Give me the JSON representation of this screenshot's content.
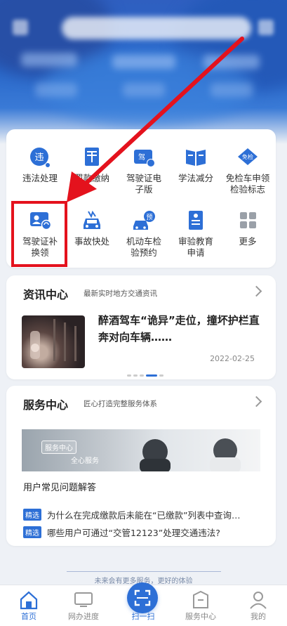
{
  "services_grid": {
    "items": [
      {
        "label": "违法处理",
        "icon": "violation-icon"
      },
      {
        "label": "罚款缴纳",
        "icon": "fine-payment-icon"
      },
      {
        "label": "驾驶证电\n子版",
        "icon": "e-license-icon"
      },
      {
        "label": "学法减分",
        "icon": "study-book-icon"
      },
      {
        "label": "免检车申领\n检验标志",
        "icon": "exempt-inspection-icon"
      },
      {
        "label": "驾驶证补\n换领",
        "icon": "license-renew-icon"
      },
      {
        "label": "事故快处",
        "icon": "accident-car-icon"
      },
      {
        "label": "机动车检\n验预约",
        "icon": "inspection-booking-icon"
      },
      {
        "label": "审验教育\n申请",
        "icon": "review-document-icon"
      },
      {
        "label": "更多",
        "icon": "more-grid-icon"
      }
    ],
    "icon_glyphs": {
      "violation": "违",
      "e_license": "驾",
      "exempt": "免检",
      "booking": "预"
    }
  },
  "news": {
    "title": "资讯中心",
    "subtitle": "最新实时地方交通资讯",
    "headline": "醉酒驾车“诡异”走位，撞坏护栏直奔对向车辆……",
    "date": "2022-02-25"
  },
  "service_center": {
    "title": "服务中心",
    "subtitle": "匠心打造完整服务体系",
    "banner_tag": "服务中心",
    "banner_text": "全心服务",
    "faq_title": "用户常见问题解答",
    "faq": [
      {
        "tag": "精选",
        "text": "为什么在完成缴款后未能在“已缴款”列表中查询…"
      },
      {
        "tag": "精选",
        "text": "哪些用户可通过“交管12123”处理交通违法?"
      }
    ]
  },
  "footer_hint": "未来会有更多服务，更好的体验",
  "bottom_nav": {
    "items": [
      {
        "label": "首页"
      },
      {
        "label": "网办进度"
      },
      {
        "label": "扫一扫"
      },
      {
        "label": "服务中心"
      },
      {
        "label": "我的"
      }
    ]
  },
  "colors": {
    "accent": "#2d6fd6",
    "highlight_box": "#e4121d",
    "arrow": "#e4121d"
  }
}
